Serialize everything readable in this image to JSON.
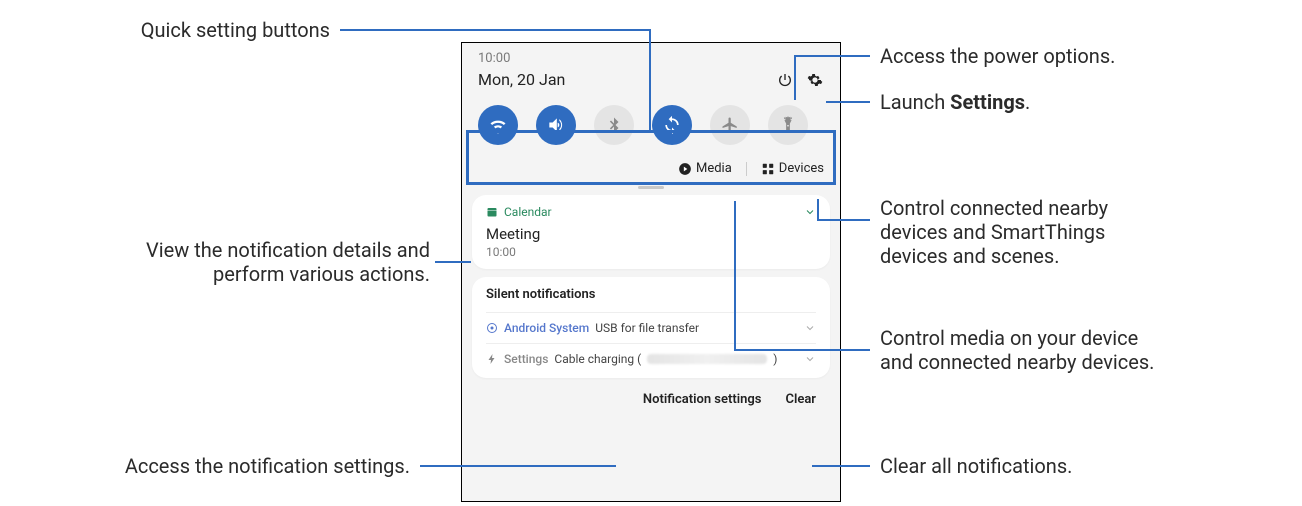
{
  "status": {
    "time": "10:00",
    "date": "Mon, 20 Jan"
  },
  "topicons": {
    "power": "power-icon",
    "settings": "gear-icon"
  },
  "quick_settings": [
    {
      "name": "wifi-icon",
      "on": true
    },
    {
      "name": "sound-icon",
      "on": true
    },
    {
      "name": "bluetooth-icon",
      "on": false
    },
    {
      "name": "autorotate-icon",
      "on": true
    },
    {
      "name": "airplane-icon",
      "on": false
    },
    {
      "name": "flashlight-icon",
      "on": false
    }
  ],
  "media_devices": {
    "media": "Media",
    "devices": "Devices"
  },
  "notification": {
    "app": "Calendar",
    "title": "Meeting",
    "time": "10:00"
  },
  "silent": {
    "header": "Silent notifications",
    "rows": [
      {
        "system": "Android System",
        "text": "USB for file transfer"
      },
      {
        "system": "Settings",
        "text": "Cable charging ("
      }
    ]
  },
  "bottom": {
    "settings": "Notification settings",
    "clear": "Clear"
  },
  "callouts": {
    "qs": "Quick setting buttons",
    "power": "Access the power options.",
    "settings_before": "Launch ",
    "settings_bold": "Settings",
    "settings_after": ".",
    "devices_l1": "Control connected nearby",
    "devices_l2": "devices and SmartThings",
    "devices_l3": "devices and scenes.",
    "notif_l1": "View the notification details and",
    "notif_l2": "perform various actions.",
    "media_l1": "Control media on your device",
    "media_l2": "and connected nearby devices.",
    "nsettings": "Access the notification settings.",
    "clear": "Clear all notifications."
  }
}
